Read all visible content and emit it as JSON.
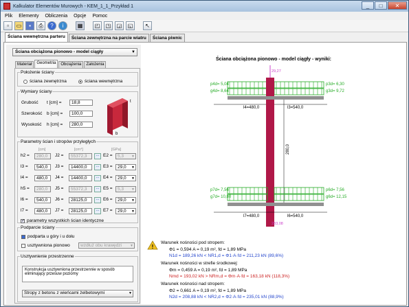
{
  "window": {
    "title": "Kalkulator Elementów Murowych - KEM_1_1_Przykład 1",
    "min": "_",
    "max": "□",
    "close": "✕"
  },
  "menu": [
    "Plik",
    "Elementy",
    "Obliczenia",
    "Opcje",
    "Pomoc"
  ],
  "toolbar": [
    "new",
    "open",
    "save",
    "print",
    "help",
    "info",
    "calc",
    "export1",
    "export2",
    "export3",
    "export4",
    "pointer"
  ],
  "main_tabs": [
    "Ściana wewnętrzna parteru",
    "Ściana zewnętrzna na parcie wiatru",
    "Ściana piwnic"
  ],
  "model_combo": "Ściana obciążona pionowo - model ciągły",
  "sub_tabs": [
    "Materiał",
    "Geometria",
    "Obciążenia",
    "Założenia"
  ],
  "polozenie": {
    "legend": "Położenie ściany",
    "opt1": "ściana zewnętrzna",
    "opt2": "ściana wewnętrzna"
  },
  "wymiary": {
    "legend": "Wymiary ściany",
    "rows": [
      {
        "label": "Grubość",
        "unit": "t [cm] =",
        "value": "18,8"
      },
      {
        "label": "Szerokość",
        "unit": "b [cm] =",
        "value": "100,0"
      },
      {
        "label": "Wysokość",
        "unit": "h [cm] =",
        "value": "280,0"
      }
    ],
    "fig_b": "b",
    "fig_t": "t"
  },
  "parametry": {
    "legend": "Parametry ścian i stropów przyległych",
    "u_cm": "[cm]",
    "u_cm4": "[cm⁴]",
    "u_gpa": "[GPa]",
    "rows": [
      {
        "h": "h2 =",
        "hv": "280,0",
        "j": "J2 =",
        "jv": "55372,3",
        "e": "E2 =",
        "ev": "5,3",
        "dis": true
      },
      {
        "h": "l3 =",
        "hv": "540,0",
        "j": "J3 =",
        "jv": "14400,0",
        "e": "E3 =",
        "ev": "29,0",
        "dis": false
      },
      {
        "h": "l4 =",
        "hv": "480,0",
        "j": "J4 =",
        "jv": "14400,0",
        "e": "E4 =",
        "ev": "29,0",
        "dis": false
      },
      {
        "h": "h5 =",
        "hv": "280,0",
        "j": "J5 =",
        "jv": "55372,3",
        "e": "E5 =",
        "ev": "5,3",
        "dis": true
      },
      {
        "h": "l6 =",
        "hv": "540,0",
        "j": "J6 =",
        "jv": "28125,0",
        "e": "E6 =",
        "ev": "29,0",
        "dis": false
      },
      {
        "h": "l7 =",
        "hv": "480,0",
        "j": "J7 =",
        "jv": "28125,0",
        "e": "E7 =",
        "ev": "29,0",
        "dis": false
      }
    ],
    "check": "parametry wszystkich ścian identyczne"
  },
  "podparcie": {
    "legend": "Podparcie ściany",
    "c1": "podparta u góry i u dołu",
    "c2": "usztywniona pionowo",
    "dd": "wzdłuż obu krawędzi"
  },
  "usztywnienie": {
    "legend": "Usztywnienie przestrzenne",
    "text": "Konstrukcja usztywniona przestrzennie w sposób eliminujący przesuw poziomy",
    "dd": "Stropy z betonu z wieńcami żelbetowymi"
  },
  "diagram": {
    "title": "Ściana obciążona pionowo - model ciągły - wyniki:",
    "p4d": "p4d= 5,04",
    "g4d": "g4d= 8,64",
    "p3d": "p3d= 6,30",
    "g3d": "g3d= 9,72",
    "l4": "l4=480,0",
    "l3": "l3=540,0",
    "p7d": "p7d= 7,56",
    "g7d": "g7d= 10,80",
    "p6d": "p6d= 7,56",
    "g6d": "g6d= 12,15",
    "l7": "l7=480,0",
    "l6": "l6=540,0",
    "h": "280,0",
    "top_load": "29,27",
    "bot_load": "233,08"
  },
  "colors": {
    "wall": "#b01848",
    "slab": "#909090",
    "load_green": "#22aa22",
    "magenta": "#cc44cc"
  },
  "results": [
    {
      "text": "Warunek nośności pod stropem:",
      "cls": ""
    },
    {
      "text": "Φ1 = 0,594   A = 0,19 m²,   fd = 1,89 MPa",
      "cls": ""
    },
    {
      "text": "N1d = 189,26 kN  <  NR1,d = Φ1·A·fd = 211,23 kN       (89,6%)",
      "cls": "blue"
    },
    {
      "text": "Warunek nośności w strefie środkowej:",
      "cls": ""
    },
    {
      "text": "Φm = 0,459   A = 0,19 m²,   fd = 1,89 MPa",
      "cls": ""
    },
    {
      "text": "Nmd = 193,02 kN  >  NRm,d = Φm·A·fd = 163,18 kN       (118,3%)",
      "cls": "red"
    },
    {
      "text": "Warunek nośności nad stropem:",
      "cls": ""
    },
    {
      "text": "Φ2 = 0,661   A = 0,19 m²,   fd = 1,89 MPa",
      "cls": ""
    },
    {
      "text": "N2d = 208,88 kN  <  NR2,d = Φ2·A·fd = 235,01 kN       (88,9%)",
      "cls": "blue"
    }
  ],
  "warn_icon": "warning-icon"
}
